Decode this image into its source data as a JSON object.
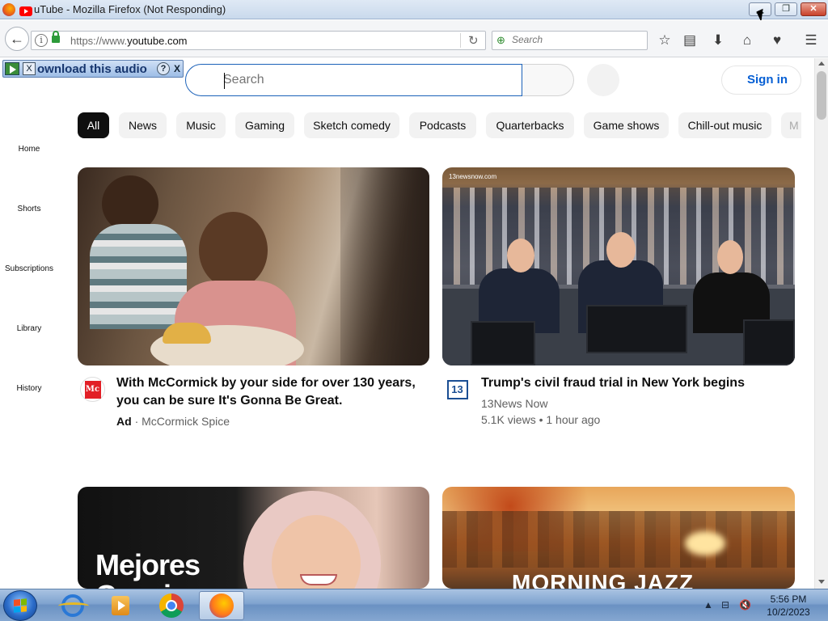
{
  "window": {
    "title": "YouTube - Mozilla Firefox (Not Responding)",
    "title_visible": "uTube - Mozilla Firefox (Not Responding)",
    "min_glyph": "▁",
    "max_glyph": "❐",
    "close_glyph": "✕"
  },
  "browser": {
    "back_glyph": "←",
    "url_prefix": "https://www.",
    "url_domain": "youtube.com",
    "reload_glyph": "↻",
    "search_placeholder": "Search",
    "toolbar_icons": [
      "star-icon",
      "reading-list-icon",
      "download-icon",
      "home-icon",
      "pocket-icon",
      "menu-icon"
    ],
    "toolbar_glyphs": [
      "☆",
      "▤",
      "⬇",
      "⌂",
      "♥",
      "☰"
    ]
  },
  "audio_bar": {
    "label": "ownload this audio",
    "help": "?",
    "close": "X",
    "close_small": "X"
  },
  "youtube": {
    "search_placeholder": "Search",
    "sign_in": "Sign in",
    "chips": [
      "All",
      "News",
      "Music",
      "Gaming",
      "Sketch comedy",
      "Podcasts",
      "Quarterbacks",
      "Game shows",
      "Chill-out music",
      "M"
    ],
    "sidebar": [
      "Home",
      "Shorts",
      "Subscriptions",
      "Library",
      "History"
    ],
    "videos": [
      {
        "title_line1": "With McCormick by your side for over 130 years,",
        "title_line2": "you can be sure It's Gonna Be Great.",
        "ad_label": "Ad",
        "channel": "McCormick Spice",
        "avatar_text": "Mc"
      },
      {
        "title": "Trump's civil fraud trial in New York begins",
        "channel": "13News Now",
        "stats": "5.1K views • 1 hour ago",
        "avatar_text": "13",
        "watermark": "13newsnow.com"
      },
      {
        "thumb_text_line1": "Mejores",
        "thumb_text_line2": "Canciones"
      },
      {
        "thumb_text": "MORNING JAZZ"
      }
    ]
  },
  "taskbar": {
    "time": "5:56 PM",
    "date": "10/2/2023",
    "tray_glyphs": [
      "▲",
      "⊟",
      "🔇"
    ]
  },
  "colors": {
    "brand_red": "#ff0000",
    "link_blue": "#065fd4",
    "chip_active": "#0f0f0f",
    "chip_bg": "#f2f2f2"
  }
}
